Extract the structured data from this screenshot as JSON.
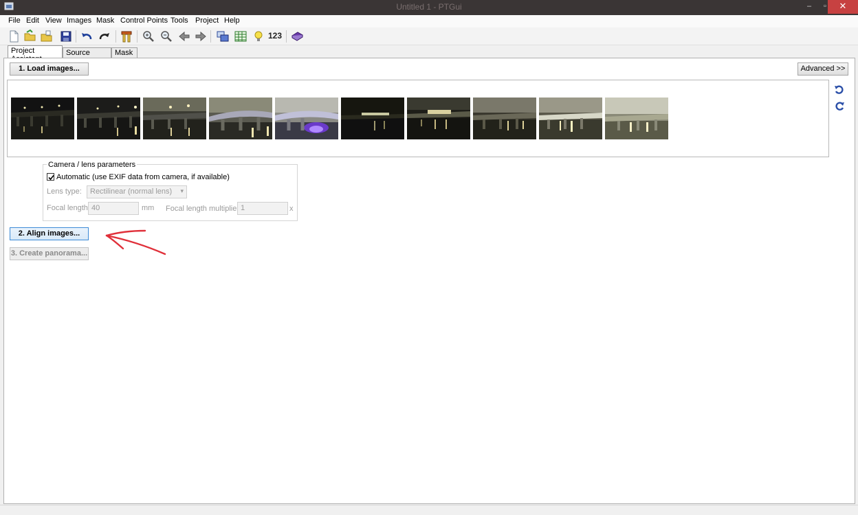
{
  "window": {
    "title": "Untitled 1 - PTGui",
    "minimize": "–",
    "maximize": "▫",
    "close": "✕"
  },
  "menu": [
    "File",
    "Edit",
    "View",
    "Images",
    "Mask",
    "Control Points",
    "Tools",
    "Project",
    "Help"
  ],
  "toolbar": {
    "icons": [
      "new-file-icon",
      "open-folder-icon",
      "open-recent-icon",
      "save-icon",
      "undo-icon",
      "redo-icon",
      "optimizer-icon",
      "zoom-in-icon",
      "zoom-out-icon",
      "previous-icon",
      "next-icon",
      "panorama-editor-icon",
      "control-point-table-icon",
      "lightbulb-icon",
      "numbers-icon",
      "help-book-icon"
    ],
    "numbers_label": "123"
  },
  "tabs": [
    "Project Assistant",
    "Source Images",
    "Mask"
  ],
  "buttons": {
    "load": "1. Load images...",
    "advanced": "Advanced >>",
    "align": "2. Align images...",
    "create": "3. Create panorama..."
  },
  "images": {
    "count": 10,
    "rotate_icons": [
      "rotate-left-icon",
      "rotate-right-icon"
    ]
  },
  "camera": {
    "legend": "Camera / lens parameters",
    "automatic_label": "Automatic (use EXIF data from camera, if available)",
    "automatic_checked": true,
    "lens_type_label": "Lens type:",
    "lens_type_value": "Rectilinear (normal lens)",
    "focal_length_label": "Focal length:",
    "focal_length_value": "40",
    "focal_length_unit": "mm",
    "multiplier_label": "Focal length multiplier:",
    "multiplier_value": "1",
    "multiplier_unit": "x"
  },
  "colors": {
    "titlebar": "#3a3535",
    "close": "#c74141",
    "primary_border": "#3c8ad6",
    "annotation": "#e0303a"
  }
}
